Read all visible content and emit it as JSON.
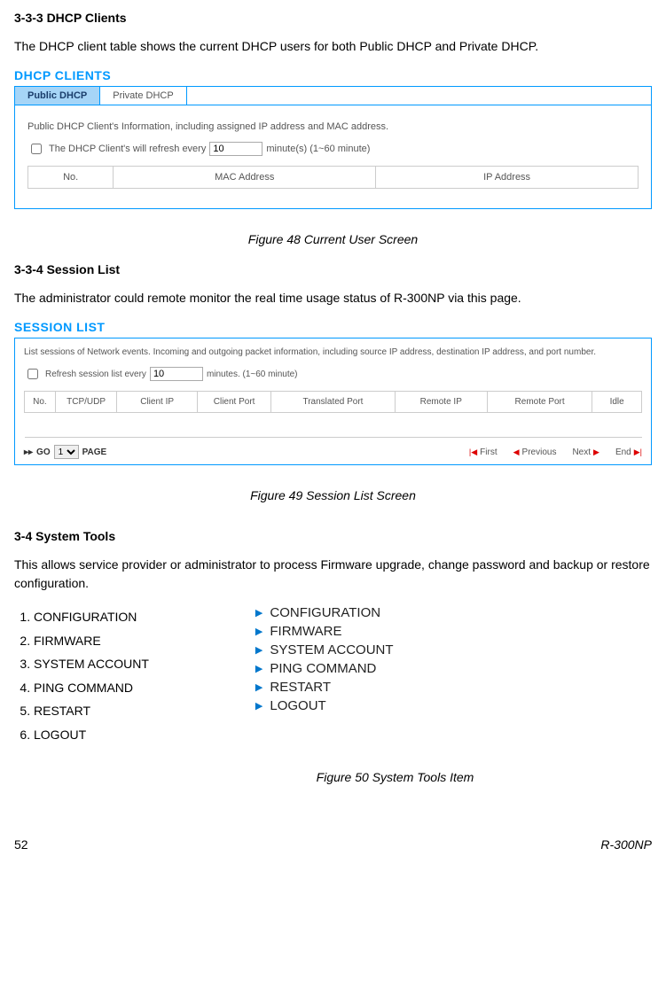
{
  "s333": {
    "heading": "3-3-3  DHCP Clients",
    "body": "The DHCP client table shows the current DHCP users for both Public DHCP and Private DHCP.",
    "panel_title": "DHCP CLIENTS",
    "tab_public": "Public DHCP",
    "tab_private": "Private DHCP",
    "info_line": "Public DHCP Client's Information, including assigned IP address and MAC address.",
    "refresh_prefix": "The DHCP Client's will refresh every",
    "refresh_value": "10",
    "refresh_suffix": "minute(s) (1~60 minute)",
    "col_no": "No.",
    "col_mac": "MAC Address",
    "col_ip": "IP Address",
    "caption": "Figure 48 Current User Screen"
  },
  "s334": {
    "heading": "3-3-4  Session List",
    "body": "The administrator could remote monitor the real time usage status of R-300NP via this page.",
    "panel_title": "SESSION LIST",
    "info_line": "List sessions of Network events. Incoming and outgoing packet information, including source IP address, destination IP address, and port number.",
    "refresh_prefix": "Refresh session list every",
    "refresh_value": "10",
    "refresh_suffix": "minutes. (1~60 minute)",
    "cols": {
      "no": "No.",
      "proto": "TCP/UDP",
      "client_ip": "Client IP",
      "client_port": "Client Port",
      "trans_port": "Translated Port",
      "remote_ip": "Remote IP",
      "remote_port": "Remote Port",
      "idle": "Idle"
    },
    "go_label": "GO",
    "page_value": "1",
    "page_suffix": "PAGE",
    "nav_first": "First",
    "nav_prev": "Previous",
    "nav_next": "Next",
    "nav_end": "End",
    "caption": "Figure 49 Session List Screen"
  },
  "s34": {
    "heading": "3-4  System Tools",
    "body": "This allows service provider or administrator to process Firmware upgrade, change password and backup or restore configuration.",
    "items": [
      "CONFIGURATION",
      "FIRMWARE",
      "SYSTEM ACCOUNT",
      "PING COMMAND",
      "RESTART",
      "LOGOUT"
    ],
    "menu": [
      "CONFIGURATION",
      "FIRMWARE",
      "SYSTEM ACCOUNT",
      "PING COMMAND",
      "RESTART",
      "LOGOUT"
    ],
    "caption": "Figure 50 System Tools Item"
  },
  "footer": {
    "page": "52",
    "model": "R-300NP"
  }
}
